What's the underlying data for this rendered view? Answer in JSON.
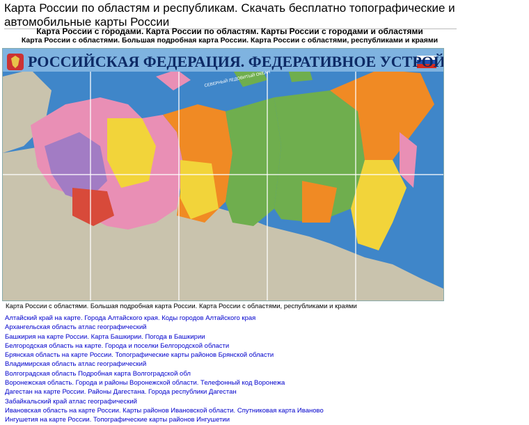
{
  "page": {
    "title": "Карта России по областям и республикам. Скачать бесплатно топографические и автомобильные карты России",
    "subtitle_main": "Карта России с городами. Карта России по областям. Карты России с городами и областями",
    "subtitle_secondary": "Карта России с областями. Большая подробная карта России. Карта России с областями, республиками и краями"
  },
  "map": {
    "banner_title": "РОССИЙСКАЯ ФЕДЕРАЦИЯ. ФЕДЕРАТИВНОЕ УСТРОЙСТВО",
    "ocean_label": "СЕВЕРНЫЙ ЛЕДОВИТЫЙ ОКЕАН",
    "colors": {
      "sea": "#3f86c9",
      "banner": "#2e5fb0",
      "banner_text": "#0d2a66",
      "land": "#c9c3ad",
      "orange": "#f08a24",
      "green": "#6fae4e",
      "yellow": "#f2d43a",
      "pink": "#e98fb5",
      "purple": "#a27cc4",
      "red": "#d84a3a"
    }
  },
  "caption": "Карта России с областями. Большая подробная карта России. Карта России с областями, республиками и краями",
  "links": [
    "Алтайский край на карте. Города Алтайского края. Коды городов Алтайского края",
    "Архангельская область атлас географический",
    "Башкирия на карте России. Карта Башкирии. Погода в Башкирии",
    "Белгородская область на карте. Города и поселки Белгородской области",
    "Брянская область на карте России. Топографические карты районов Брянской области",
    "Владимирская область атлас географический",
    "Волгоградская область Подробная карта Волгоградской обл",
    "Воронежская область. Города и районы Воронежской области. Телефонный код Воронежа",
    "Дагестан на карте России. Районы Дагестана. Города республики Дагестан",
    "Забайкальский край атлас географический",
    "Ивановская область на карте России. Карты районов Ивановской области. Спутниковая карта Иваново",
    "Ингушетия на карте России. Топографические карты районов Ингушетии"
  ]
}
